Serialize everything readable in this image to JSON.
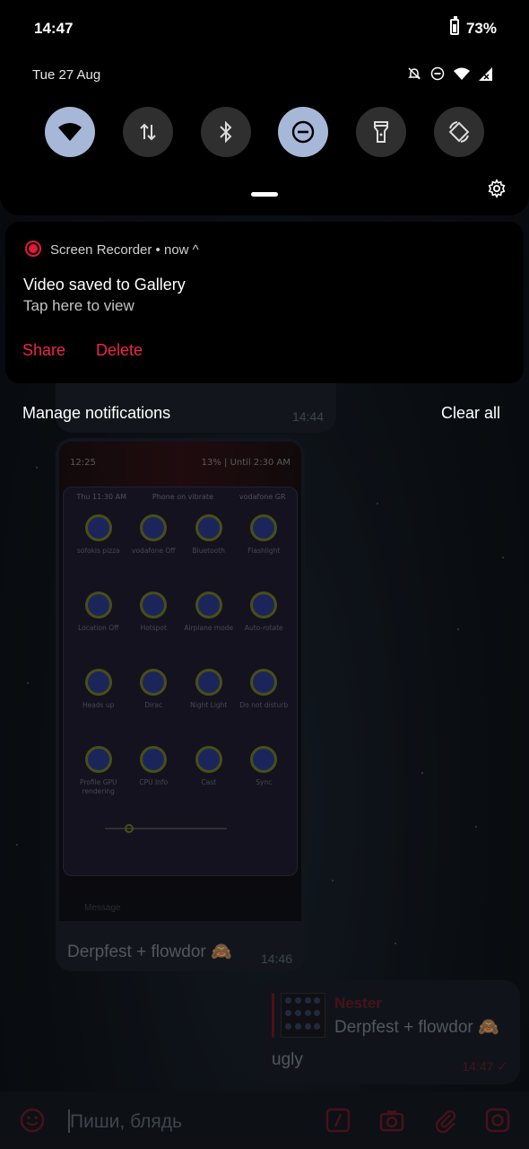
{
  "status_bar": {
    "time": "14:47",
    "battery": "73%"
  },
  "shade": {
    "date": "Tue 27 Aug",
    "status_icons": [
      "notifications-off-icon",
      "do-not-disturb-icon",
      "wifi-icon",
      "mobile-signal-no-data-icon"
    ],
    "quick_settings": [
      {
        "id": "wifi",
        "icon": "wifi-icon",
        "active": true
      },
      {
        "id": "mobile-data",
        "icon": "data-transfer-icon",
        "active": false
      },
      {
        "id": "bluetooth",
        "icon": "bluetooth-icon",
        "active": false
      },
      {
        "id": "do-not-disturb",
        "icon": "do-not-disturb-icon",
        "active": true
      },
      {
        "id": "flashlight",
        "icon": "flashlight-icon",
        "active": false
      },
      {
        "id": "auto-rotate",
        "icon": "auto-rotate-icon",
        "active": false
      }
    ],
    "accent_on": "#a7b7d8"
  },
  "notification": {
    "app": "Screen Recorder • now ^",
    "title": "Video saved to Gallery",
    "body": "Tap here to view",
    "actions": [
      "Share",
      "Delete"
    ],
    "action_color": "#ee2648"
  },
  "footer": {
    "manage": "Manage notifications",
    "clear": "Clear all"
  },
  "chat": {
    "msg1_time": "14:44",
    "screenshot": {
      "time": "12:25",
      "battery": "13% | Until 2:30 AM",
      "status": [
        "Thu 11:30 AM",
        "Phone on vibrate",
        "vodafone GR"
      ],
      "tiles": [
        "sofokis pizza",
        "vodafone Off",
        "Bluetooth",
        "Flashlight",
        "Location Off",
        "Hotspot",
        "Airplane mode",
        "Auto-rotate",
        "Heads up",
        "Dirac",
        "Night Light",
        "Do not disturb",
        "Profile GPU rendering",
        "CPU Info",
        "Cast",
        "Sync"
      ],
      "input_placeholder": "Message"
    },
    "msg2_caption": "Derpfest + flowdor 🙈",
    "msg2_time": "14:46",
    "reply": {
      "name": "Nester",
      "quoted": "Derpfest + flowdor 🙈",
      "text": "ugly",
      "time": "14:47 ✓"
    }
  },
  "input": {
    "placeholder": "Пиши, блядь"
  }
}
